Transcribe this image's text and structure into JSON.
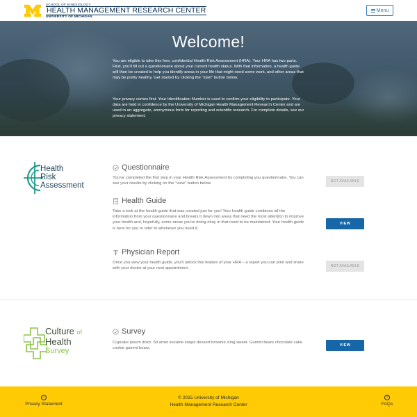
{
  "header": {
    "logo_small": "SCHOOL OF KINESIOLOGY",
    "logo_main": "HEALTH MANAGEMENT RESEARCH CENTER",
    "logo_sub": "UNIVERSITY OF MICHIGAN",
    "menu_label": "Menu"
  },
  "hero": {
    "title": "Welcome!",
    "paragraph1": "You are eligible to take this free, confidential Health Risk Assessment (HRA). Your HRA has two parts. First, you'll fill out a questionnaire about your current health status. With that information, a health guide will then be created to help you identify areas in your life that might need some work, and other areas that may be pretty healthy. Get started by clicking the \"start\" button below.",
    "paragraph2": "Your privacy comes first. Your Identification Number is used to confirm your eligibility to participate. Your data are held in confidence by the University of Michigan Health Management Research Center and are used in an aggregate, anonymous form for reporting and scientific research. For complete details, see our privacy statement."
  },
  "hra_logo": {
    "line1_cap": "H",
    "line1_rest": "ealth",
    "line2_cap": "R",
    "line2_rest": "isk",
    "line3_cap": "A",
    "line3_rest": "ssessment"
  },
  "items": [
    {
      "icon": "check-circle-icon",
      "title": "Questionnaire",
      "description": "You've completed the first step in your Health Risk Assessment by completing you questionnaire. You can see your results by clicking on the \"view\" button below.",
      "button_label": "NOT AVAILABLE",
      "button_state": "disabled"
    },
    {
      "icon": "document-icon",
      "title": "Health Guide",
      "description": "Take a look at the health guide that was created just for you! Your health guide combines all the information from your questionnaire and breaks it down into areas that need the most attention to improve your health and, hopefully, some areas you're doing okay in that need to be maintained. Your health guide is here for you to refer to whenever you need it.",
      "button_label": "VIEW",
      "button_state": "enabled"
    },
    {
      "icon": "caduceus-icon",
      "title": "Physician Report",
      "description": "Once you view your health guide, you'll unlock this feature of your HRA – a report you can print and share with your doctor at your next appointment.",
      "button_label": "NOT AVAILABLE",
      "button_state": "disabled"
    }
  ],
  "coh_logo": {
    "line1": "Culture",
    "of": "of",
    "line2": "Health",
    "line3": "Survey"
  },
  "survey": {
    "icon": "check-circle-icon",
    "title": "Survey",
    "description": "Cupcake ipsum dolor. Sit amet sesame snaps dessert brownie icing sweet. Gummi bears chocolate cake cookie gummi bears.",
    "button_label": "VIEW"
  },
  "footer": {
    "privacy_label": "Privacy Statement",
    "privacy_icon": "info-icon",
    "copyright_symbol": "©",
    "copyright_line1": "2015 University of Michigan",
    "copyright_line2": "Health Management Research Center",
    "faq_label": "FAQs",
    "faq_icon": "question-icon"
  },
  "colors": {
    "maize": "#ffcb05",
    "blue": "#00274c",
    "view_button": "#1666a8",
    "hra_teal": "#1f9a8a",
    "coh_green": "#8bc34a"
  }
}
